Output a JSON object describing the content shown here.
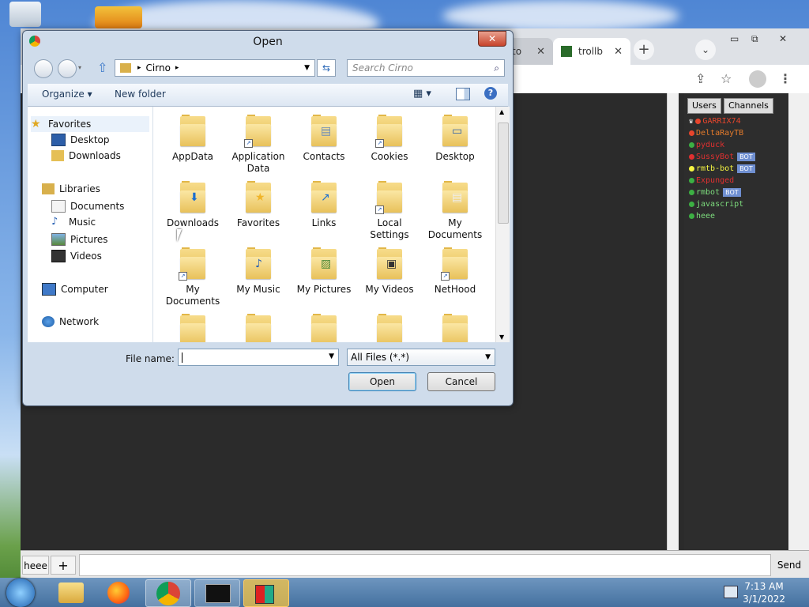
{
  "browser": {
    "tabs": [
      {
        "label": "to",
        "close": "✕"
      },
      {
        "label": "trollb",
        "close": "✕"
      }
    ],
    "new_tab": "+",
    "window_controls": {
      "minimize": "▭",
      "restore": "⧉",
      "close": "✕"
    }
  },
  "trollbox": {
    "panel_tabs": [
      "Users",
      "Channels"
    ],
    "users": [
      {
        "name": "GARRIX74",
        "color": "#e8452c",
        "dot": "#e8452c",
        "bot": false,
        "icon": "♛"
      },
      {
        "name": "DeltaRayTB",
        "color": "#e57b2b",
        "dot": "#e8452c",
        "bot": false
      },
      {
        "name": "pyduck",
        "color": "#e03030",
        "dot": "#3cb043",
        "bot": false
      },
      {
        "name": "SussyBot",
        "color": "#e03030",
        "dot": "#e03030",
        "bot": true
      },
      {
        "name": "rmtb-bot",
        "color": "#f5f542",
        "dot": "#f5f542",
        "bot": true
      },
      {
        "name": "Expunged",
        "color": "#e03030",
        "dot": "#3cb043",
        "bot": false
      },
      {
        "name": "rmbot",
        "color": "#7ddc7d",
        "dot": "#3cb043",
        "bot": true
      },
      {
        "name": "javascript",
        "color": "#7ddc7d",
        "dot": "#3cb043",
        "bot": false
      },
      {
        "name": "heee",
        "color": "#7ddc7d",
        "dot": "#3cb043",
        "bot": false
      }
    ],
    "bot_badge": "BOT",
    "channel_button": "heee",
    "add_button": "+",
    "send_button": "Send"
  },
  "dialog": {
    "title": "Open",
    "close": "✕",
    "path_root_icon": "library-icon",
    "path_segment": "Cirno",
    "search_placeholder": "Search Cirno",
    "organize": "Organize ▾",
    "new_folder": "New folder",
    "nav": {
      "favorites_header": "Favorites",
      "favorites": [
        "Desktop",
        "Downloads"
      ],
      "libraries_header": "Libraries",
      "libraries": [
        "Documents",
        "Music",
        "Pictures",
        "Videos"
      ],
      "computer": "Computer",
      "network": "Network"
    },
    "files": [
      {
        "name": "AppData",
        "overlay": ""
      },
      {
        "name": "Application Data",
        "overlay": "shortcut"
      },
      {
        "name": "Contacts",
        "overlay": "contacts"
      },
      {
        "name": "Cookies",
        "overlay": "shortcut"
      },
      {
        "name": "Desktop",
        "overlay": "desktop"
      },
      {
        "name": "Downloads",
        "overlay": "download"
      },
      {
        "name": "Favorites",
        "overlay": "star"
      },
      {
        "name": "Links",
        "overlay": "link"
      },
      {
        "name": "Local Settings",
        "overlay": "shortcut"
      },
      {
        "name": "My Documents",
        "overlay": "docs"
      },
      {
        "name": "My Documents",
        "overlay": "shortcut"
      },
      {
        "name": "My Music",
        "overlay": "music"
      },
      {
        "name": "My Pictures",
        "overlay": "pictures"
      },
      {
        "name": "My Videos",
        "overlay": "videos"
      },
      {
        "name": "NetHood",
        "overlay": "shortcut"
      }
    ],
    "file_name_label": "File name:",
    "file_name_value": "",
    "file_type": "All Files (*.*)",
    "open_button": "Open",
    "cancel_button": "Cancel"
  },
  "taskbar": {
    "time": "7:13 AM",
    "date": "3/1/2022",
    "apps": [
      "windows-explorer",
      "firefox",
      "chrome",
      "command-prompt",
      "app"
    ]
  },
  "colors": {
    "dialog_frame": "#cfdceb",
    "page_background": "#2b2b2b",
    "taskbar": "#44709f"
  }
}
